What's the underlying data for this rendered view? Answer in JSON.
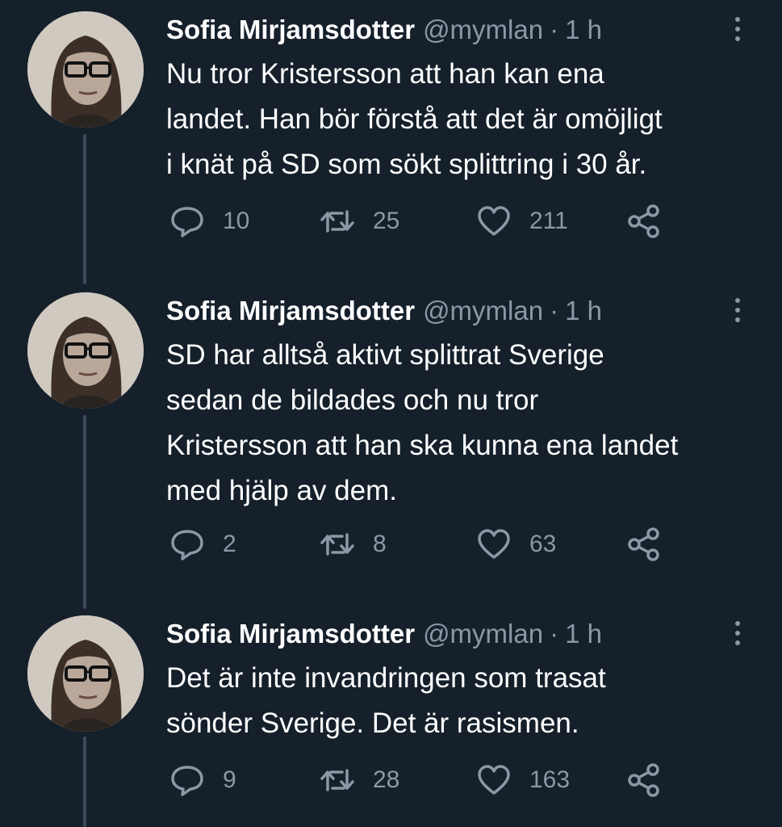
{
  "colors": {
    "background": "#15202b",
    "text": "#ffffff",
    "muted": "#8b98a5",
    "thread_line": "#3a4a5a"
  },
  "tweets": [
    {
      "author": {
        "name": "Sofia Mirjamsdotter",
        "handle": "@mymlan"
      },
      "dot": "·",
      "time": "1 h",
      "text": "Nu tror Kristersson att han kan ena\nlandet. Han bör förstå att det är omöjligt\ni knät på SD som sökt splittring i 30 år.",
      "replies": "10",
      "retweets": "25",
      "likes": "211"
    },
    {
      "author": {
        "name": "Sofia Mirjamsdotter",
        "handle": "@mymlan"
      },
      "dot": "·",
      "time": "1 h",
      "text": "SD har alltså aktivt splittrat Sverige\nsedan de bildades och nu tror\nKristersson att han ska kunna ena landet\nmed hjälp av dem.",
      "replies": "2",
      "retweets": "8",
      "likes": "63"
    },
    {
      "author": {
        "name": "Sofia Mirjamsdotter",
        "handle": "@mymlan"
      },
      "dot": "·",
      "time": "1 h",
      "text": "Det är inte invandringen som trasat\nsönder Sverige. Det är rasismen.",
      "replies": "9",
      "retweets": "28",
      "likes": "163"
    }
  ],
  "icons": {
    "reply": "reply-icon",
    "retweet": "retweet-icon",
    "like": "heart-icon",
    "share": "share-icon",
    "more": "more-options-icon"
  }
}
